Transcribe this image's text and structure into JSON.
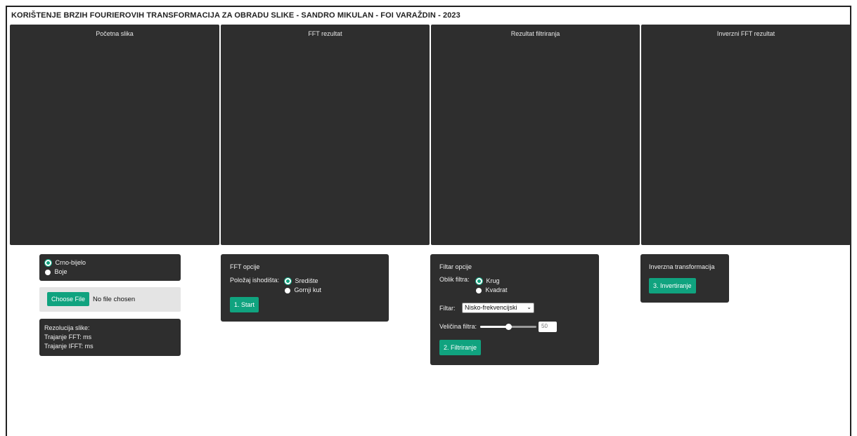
{
  "title": "KORIŠTENJE BRZIH FOURIEROVIH TRANSFORMACIJA ZA OBRADU SLIKE - SANDRO MIKULAN - FOI VARAŽDIN - 2023",
  "panels": {
    "initial": "Početna slika",
    "fft": "FFT rezultat",
    "filtered": "Rezultat filtriranja",
    "inverse": "Inverzni FFT rezultat"
  },
  "color_mode": {
    "options": [
      "Crno-bijelo",
      "Boje"
    ],
    "selected": "Crno-bijelo"
  },
  "file_input": {
    "button_label": "Choose File",
    "status": "No file chosen"
  },
  "info": {
    "resolution": "Rezolucija slike:",
    "fft_time": "Trajanje FFT: ms",
    "ifft_time": "Trajanje IFFT: ms"
  },
  "fft_options": {
    "heading": "FFT opcije",
    "origin_label": "Položaj ishodišta:",
    "origin_options": [
      "Središte",
      "Gornji kut"
    ],
    "origin_selected": "Središte",
    "start_label": "1. Start"
  },
  "filter_options": {
    "heading": "Filtar opcije",
    "shape_label": "Oblik filtra:",
    "shape_options": [
      "Krug",
      "Kvadrat"
    ],
    "shape_selected": "Krug",
    "filter_label": "Filtar:",
    "filter_selected": "Nisko-frekvencijski",
    "size_label": "Veličina filtra:",
    "size_value": "50",
    "size_fraction": 0.5,
    "run_label": "2. Filtriranje"
  },
  "inverse_options": {
    "heading": "Inverzna transformacija",
    "invert_label": "3. Invertiranje"
  },
  "colors": {
    "panel_bg": "#2e2e2e",
    "accent": "#10a37f"
  }
}
